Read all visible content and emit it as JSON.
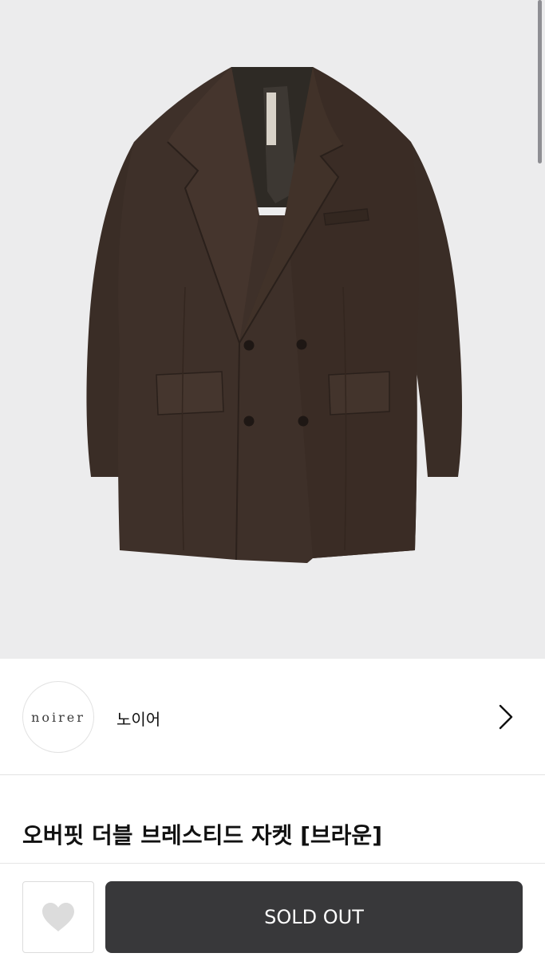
{
  "product": {
    "image_alt": "브라운 오버핏 더블 브레스티드 자켓",
    "title": "오버핏 더블 브레스티드 자켓 [브라운]"
  },
  "brand": {
    "logo_text": "noirer",
    "name": "노이어"
  },
  "icons": {
    "brand_link": "chevron-right-icon",
    "like": "heart-icon"
  },
  "actions": {
    "buy_label": "SOLD OUT"
  },
  "colors": {
    "image_background": "#ececed",
    "jacket": "#3a2d26",
    "button_background": "#38383a",
    "button_text": "#ffffff",
    "heart": "#dcdcdc"
  }
}
